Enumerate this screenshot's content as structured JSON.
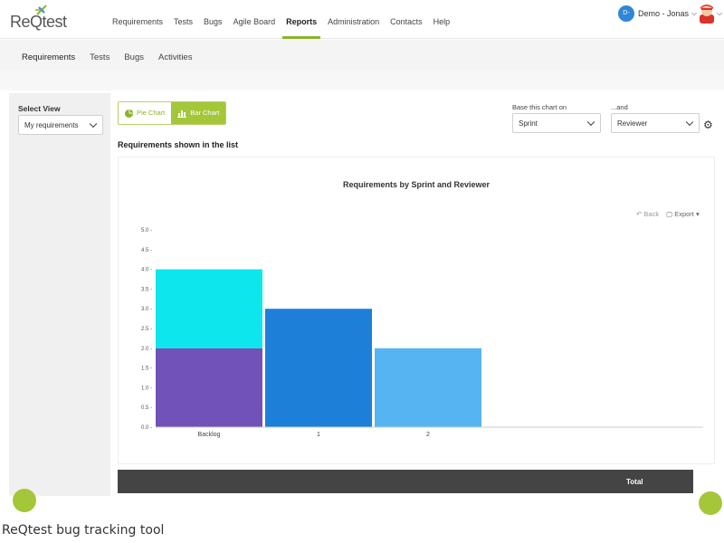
{
  "app": {
    "logo": "ReQtest"
  },
  "nav": {
    "items": [
      "Requirements",
      "Tests",
      "Bugs",
      "Agile Board",
      "Reports",
      "Administration",
      "Contacts",
      "Help"
    ],
    "active": "Reports"
  },
  "user": {
    "initials": "D-",
    "name": "Demo - Jonas"
  },
  "subtabs": {
    "items": [
      "Requirements",
      "Tests",
      "Bugs",
      "Activities"
    ],
    "active": "Requirements"
  },
  "sidebar": {
    "title": "Select View",
    "view_value": "My requirements"
  },
  "chart_toggle": {
    "pie_label": "Pie Chart",
    "bar_label": "Bar Chart",
    "selected": "Bar Chart"
  },
  "chart_settings": {
    "base_label": "Base this chart on",
    "base_value": "Sprint",
    "and_label": "...and",
    "and_value": "Reviewer"
  },
  "section_title": "Requirements shown in the list",
  "chart_tools": {
    "back": "Back",
    "export": "Export"
  },
  "table": {
    "total_header": "Total"
  },
  "caption": "ReQtest bug tracking tool",
  "colors": {
    "accent": "#a4c639",
    "nav_underline": "#8ab52a",
    "user_avatar": "#2f86d6"
  },
  "chart_data": {
    "type": "bar",
    "stacked": true,
    "title": "Requirements by Sprint and Reviewer",
    "xlabel": "",
    "ylabel": "",
    "categories": [
      "Backlog",
      "1",
      "2"
    ],
    "ylim": [
      0,
      5
    ],
    "yticks": [
      "0.0",
      "0.5",
      "1.0",
      "1.5",
      "2.0",
      "2.5",
      "3.0",
      "3.5",
      "4.0",
      "4.5",
      "5.0"
    ],
    "grid": false,
    "legend": "none",
    "segments": [
      {
        "category": "Backlog",
        "from": 0,
        "to": 2,
        "color": "#7152b8"
      },
      {
        "category": "Backlog",
        "from": 2,
        "to": 4,
        "color": "#0de6ec"
      },
      {
        "category": "1",
        "from": 0,
        "to": 3,
        "color": "#1e7fd8"
      },
      {
        "category": "2",
        "from": 0,
        "to": 2,
        "color": "#56b4f2"
      }
    ]
  }
}
